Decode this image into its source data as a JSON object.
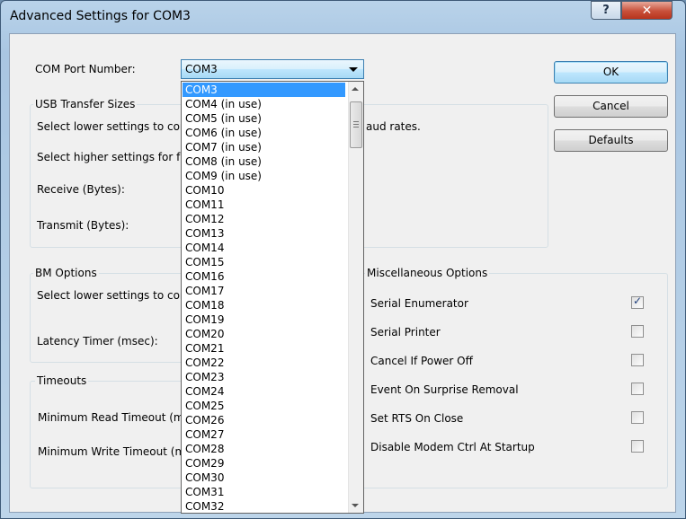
{
  "window": {
    "title": "Advanced Settings for COM3",
    "help_label": "?",
    "close_label": "✕"
  },
  "com_port": {
    "label": "COM Port Number:",
    "value": "COM3",
    "options": [
      "COM3",
      "COM4 (in use)",
      "COM5 (in use)",
      "COM6 (in use)",
      "COM7 (in use)",
      "COM8 (in use)",
      "COM9 (in use)",
      "COM10",
      "COM11",
      "COM12",
      "COM13",
      "COM14",
      "COM15",
      "COM16",
      "COM17",
      "COM18",
      "COM19",
      "COM20",
      "COM21",
      "COM22",
      "COM23",
      "COM24",
      "COM25",
      "COM26",
      "COM27",
      "COM28",
      "COM29",
      "COM30",
      "COM31",
      "COM32"
    ],
    "selected_index": 0
  },
  "usb": {
    "title": "USB Transfer Sizes",
    "line1": "Select lower settings to corr",
    "line1_tail": "aud rates.",
    "line2": "Select higher settings for fas",
    "receive": "Receive (Bytes):",
    "transmit": "Transmit (Bytes):"
  },
  "bm": {
    "title": "BM Options",
    "line1": "Select lower settings to corr",
    "latency": "Latency Timer (msec):"
  },
  "timeouts": {
    "title": "Timeouts",
    "read": "Minimum Read Timeout (ms",
    "write": "Minimum Write Timeout (ms"
  },
  "misc": {
    "title": "Miscellaneous Options",
    "options": [
      {
        "label": "Serial Enumerator",
        "checked": true
      },
      {
        "label": "Serial Printer",
        "checked": false
      },
      {
        "label": "Cancel If Power Off",
        "checked": false
      },
      {
        "label": "Event On Surprise Removal",
        "checked": false
      },
      {
        "label": "Set RTS On Close",
        "checked": false
      },
      {
        "label": "Disable Modem Ctrl At Startup",
        "checked": false
      }
    ]
  },
  "buttons": {
    "ok": "OK",
    "cancel": "Cancel",
    "defaults": "Defaults"
  },
  "colors": {
    "selection": "#3399ff",
    "title_close": "#c8503a"
  }
}
